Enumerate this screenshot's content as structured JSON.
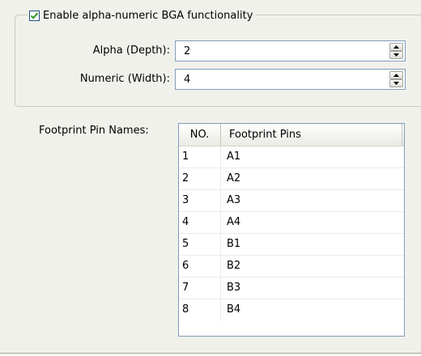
{
  "bga_group": {
    "enable_label": "Enable alpha-numeric BGA functionality",
    "enabled": true,
    "alpha": {
      "label": "Alpha (Depth):",
      "value": "2"
    },
    "numeric": {
      "label": "Numeric (Width):",
      "value": "4"
    }
  },
  "pins": {
    "label": "Footprint Pin Names:",
    "columns": [
      "NO.",
      "Footprint Pins"
    ],
    "rows": [
      {
        "no": "1",
        "pin": "A1"
      },
      {
        "no": "2",
        "pin": "A2"
      },
      {
        "no": "3",
        "pin": "A3"
      },
      {
        "no": "4",
        "pin": "A4"
      },
      {
        "no": "5",
        "pin": "B1"
      },
      {
        "no": "6",
        "pin": "B2"
      },
      {
        "no": "7",
        "pin": "B3"
      },
      {
        "no": "8",
        "pin": "B4"
      }
    ]
  },
  "colors": {
    "checkmark": "#2a9a1f",
    "field_border": "#7f9db9",
    "background": "#f1f1ec"
  },
  "icons": {
    "check": "check-icon",
    "spin_up": "arrow-up-icon",
    "spin_down": "arrow-down-icon"
  }
}
